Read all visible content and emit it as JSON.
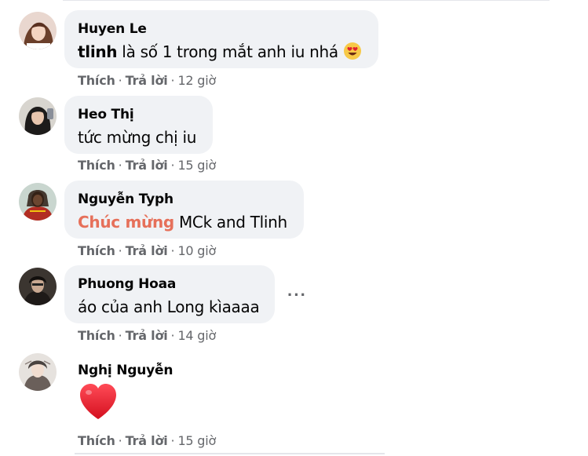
{
  "comments": [
    {
      "author": "Huyen Le",
      "mention": "tlinh",
      "text": " là số 1 trong mắt anh iu nhá ",
      "emoji_icon": "heart-eyes-emoji",
      "like_label": "Thích",
      "reply_label": "Trả lời",
      "separator": "·",
      "time": "12 giờ"
    },
    {
      "author": "Heo Thị",
      "text": "tức mừng chị iu",
      "like_label": "Thích",
      "reply_label": "Trả lời",
      "separator": "·",
      "time": "15 giờ"
    },
    {
      "author": "Nguyễn Typh",
      "highlight": "Chúc mừng",
      "text": " MCk and Tlinh",
      "like_label": "Thích",
      "reply_label": "Trả lời",
      "separator": "·",
      "time": "10 giờ"
    },
    {
      "author": "Phuong Hoaa",
      "text": "áo của anh Long kìaaaa",
      "more_label": "···",
      "like_label": "Thích",
      "reply_label": "Trả lời",
      "separator": "·",
      "time": "14 giờ"
    },
    {
      "author": "Nghị Nguyễn",
      "emoji_icon": "red-heart-emoji",
      "like_label": "Thích",
      "reply_label": "Trả lời",
      "separator": "·",
      "time": "15 giờ"
    }
  ],
  "colors": {
    "bubble": "#f0f2f5",
    "secondary_text": "#65676b",
    "highlight_text": "#e6705a",
    "heart": "#e0202e"
  }
}
